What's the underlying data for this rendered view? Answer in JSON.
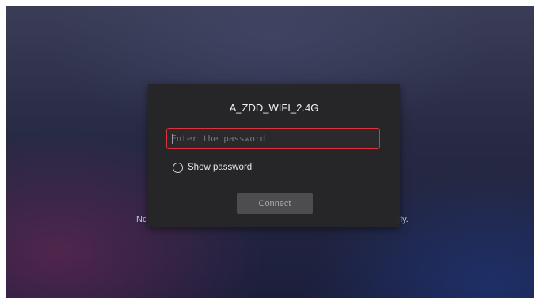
{
  "background": {
    "message_left_fragment": "Nc",
    "message_right_fragment": "rly."
  },
  "dialog": {
    "network_name": "A_ZDD_WIFI_2.4G",
    "password": {
      "value": "",
      "placeholder": "Enter the password"
    },
    "show_password": {
      "label": "Show password",
      "checked": false
    },
    "connect_label": "Connect"
  },
  "colors": {
    "focus_border": "#e0323c",
    "dialog_background": "#262628",
    "button_background": "#4d4d50"
  }
}
